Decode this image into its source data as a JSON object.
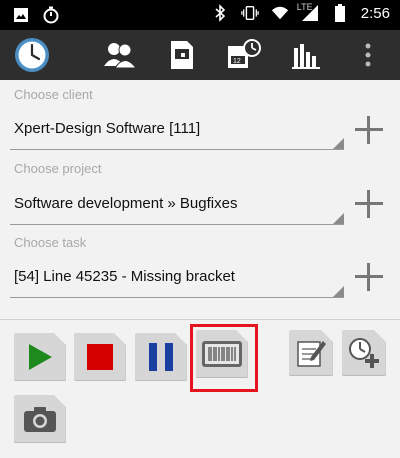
{
  "status_bar": {
    "icons_left": [
      "image-icon",
      "timer-icon"
    ],
    "icons_right": [
      "bluetooth-icon",
      "vibrate-icon",
      "wifi-icon",
      "signal-icon",
      "battery-icon"
    ],
    "network": "LTE",
    "time": "2:56"
  },
  "app_bar": {
    "icons": [
      "clock-logo-icon",
      "clients-icon",
      "project-icon",
      "calendar-clock-icon",
      "statistics-icon",
      "overflow-menu-icon"
    ]
  },
  "form": {
    "client": {
      "label": "Choose client",
      "value": "Xpert-Design Software [111]"
    },
    "project": {
      "label": "Choose project",
      "value": "Software development » Bugfixes"
    },
    "task": {
      "label": "Choose task",
      "value": "[54] Line 45235 - Missing bracket"
    }
  },
  "toolbar": {
    "buttons": [
      "play-icon",
      "stop-icon",
      "pause-icon",
      "barcode-icon",
      "edit-note-icon",
      "add-time-icon",
      "camera-icon"
    ]
  },
  "colors": {
    "accent_highlight": "#e8141d",
    "play": "#1e8a1e",
    "stop": "#d40000",
    "pause": "#1a3fa0",
    "app_bar": "#2e2e2e"
  }
}
